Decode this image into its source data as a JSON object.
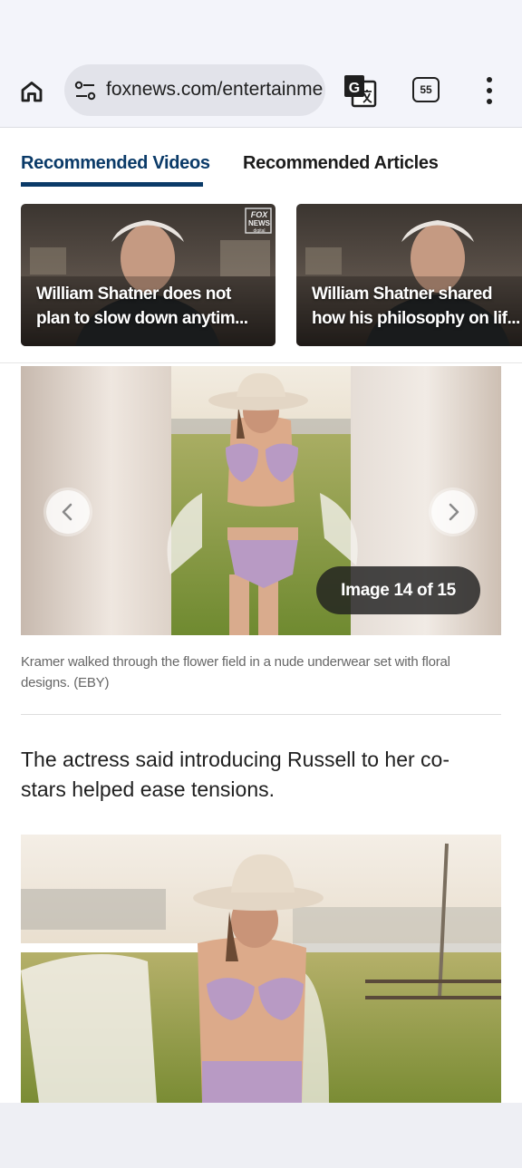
{
  "browser": {
    "url_text": "foxnews.com/entertainme",
    "tab_count": "55"
  },
  "reco": {
    "tabs": [
      {
        "label": "Recommended Videos",
        "active": true
      },
      {
        "label": "Recommended Articles",
        "active": false
      }
    ],
    "videos": [
      {
        "title_line1": "William Shatner does not",
        "title_line2": "plan to slow down anytim..."
      },
      {
        "title_line1": "William Shatner shared",
        "title_line2": "how his philosophy on lif..."
      }
    ],
    "fox_logo_text": [
      "FOX",
      "NEWS",
      "digital"
    ]
  },
  "gallery": {
    "counter": "Image 14 of 15",
    "caption": "Kramer walked through the flower field in a nude underwear set with floral designs. (EBY)"
  },
  "article": {
    "paragraph": "The actress said introducing Russell to her co-stars helped ease tensions."
  },
  "colors": {
    "accent_navy": "#0a3a68",
    "browser_chrome": "#f3f4fa",
    "url_pill": "#e2e3ea"
  },
  "icons": [
    "home-icon",
    "tune-icon",
    "translate-icon",
    "tabs-icon",
    "more-vert-icon",
    "chevron-left-icon",
    "chevron-right-icon"
  ]
}
